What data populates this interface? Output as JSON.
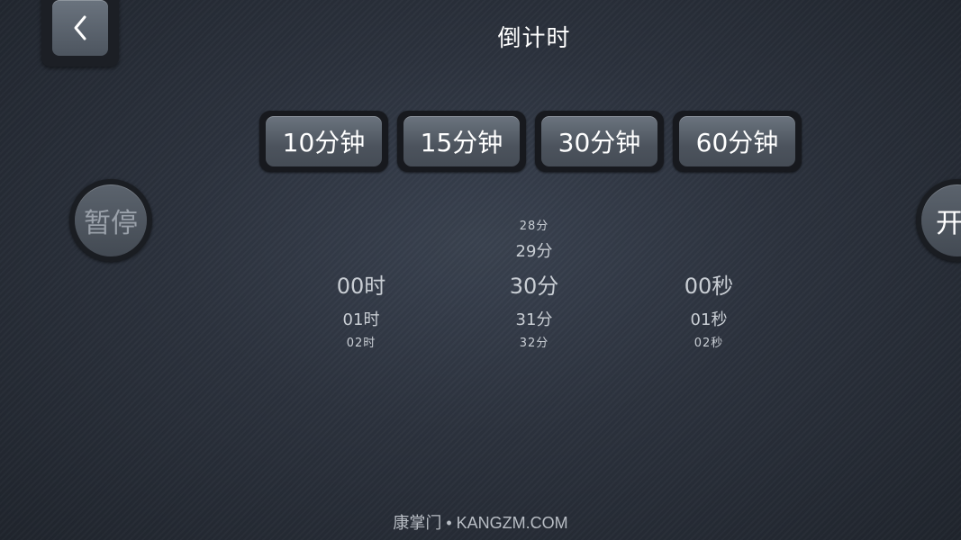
{
  "header": {
    "back_icon": "chevron-left-icon",
    "title": "倒计时"
  },
  "presets": [
    {
      "label": "10分钟"
    },
    {
      "label": "15分钟"
    },
    {
      "label": "30分钟"
    },
    {
      "label": "60分钟"
    }
  ],
  "controls": {
    "pause_label": "暂停",
    "start_label": "开始"
  },
  "pickers": {
    "hours": {
      "above2": "",
      "above1": "",
      "selected": "00时",
      "below1": "01时",
      "below2": "02时"
    },
    "minutes": {
      "above2": "28分",
      "above1": "29分",
      "selected": "30分",
      "below1": "31分",
      "below2": "32分"
    },
    "seconds": {
      "above2": "",
      "above1": "",
      "selected": "00秒",
      "below1": "01秒",
      "below2": "02秒"
    }
  },
  "colors": {
    "selected_value": "#f0643a",
    "background": "#2c323d"
  },
  "watermark": "康掌门 • KANGZM.COM"
}
